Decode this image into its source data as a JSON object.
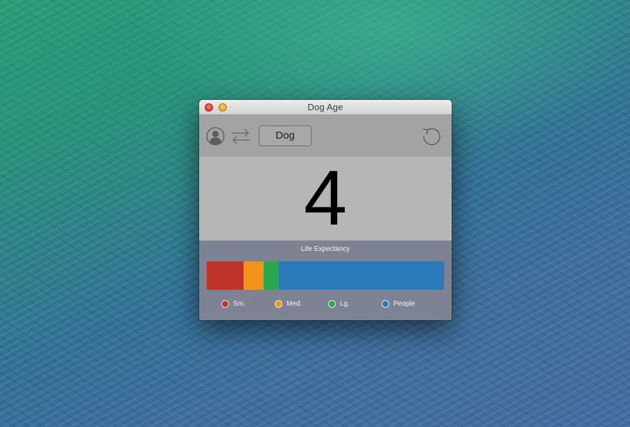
{
  "window": {
    "title": "Dog Age"
  },
  "toolbar": {
    "person_icon": "person-icon",
    "swap_icon": "swap-arrows-icon",
    "mode_label": "Dog",
    "reset_icon": "reset-icon"
  },
  "age": {
    "value": "4"
  },
  "life_expectancy": {
    "title": "Life Expectancy",
    "segments": [
      {
        "name": "Sm.",
        "fraction": 0.155,
        "color": "#c0332b"
      },
      {
        "name": "Med.",
        "fraction": 0.085,
        "color": "#f39318"
      },
      {
        "name": "Lg.",
        "fraction": 0.065,
        "color": "#2aa851"
      },
      {
        "name": "People",
        "fraction": 0.695,
        "color": "#2a79b8"
      }
    ]
  },
  "colors": {
    "toolbar_bg": "#a3a3a3",
    "age_bg": "#b6b6b6",
    "life_bg": "#7d8393"
  }
}
